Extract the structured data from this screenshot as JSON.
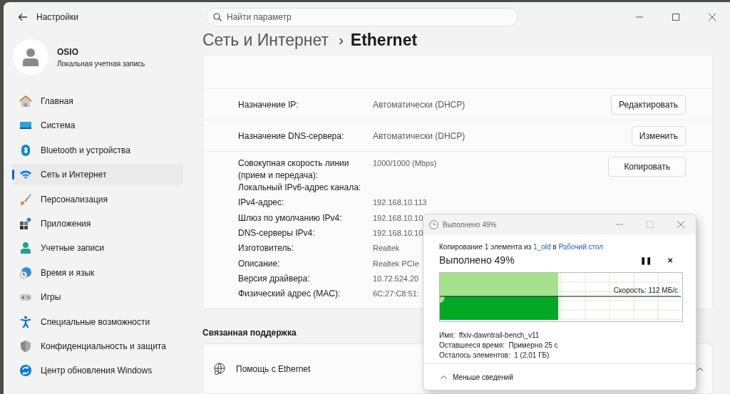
{
  "window": {
    "title": "Настройки",
    "search": {
      "placeholder": "Найти параметр"
    }
  },
  "profile": {
    "name": "OSIO",
    "account": "Локальная учетная запись"
  },
  "sidebar": {
    "items": [
      {
        "label": "Главная",
        "selected": false
      },
      {
        "label": "Система",
        "selected": false
      },
      {
        "label": "Bluetooth и устройства",
        "selected": false
      },
      {
        "label": "Сеть и Интернет",
        "selected": true
      },
      {
        "label": "Персонализация",
        "selected": false
      },
      {
        "label": "Приложения",
        "selected": false
      },
      {
        "label": "Учетные записи",
        "selected": false
      },
      {
        "label": "Время и язык",
        "selected": false
      },
      {
        "label": "Игры",
        "selected": false
      },
      {
        "label": "Специальные возможности",
        "selected": false
      },
      {
        "label": "Конфиденциальность и защита",
        "selected": false
      },
      {
        "label": "Центр обновления Windows",
        "selected": false
      }
    ]
  },
  "breadcrumb": {
    "parent": "Сеть и Интернет",
    "separator": "›",
    "current": "Ethernet"
  },
  "settings": [
    {
      "label": "Назначение IP:",
      "value": "Автоматически (DHCP)",
      "button": "Редактировать"
    },
    {
      "label": "Назначение DNS-сервера:",
      "value": "Автоматически (DHCP)",
      "button": "Изменить"
    }
  ],
  "properties": {
    "button": "Копировать",
    "rows": [
      {
        "label": "Совокупная скорость линии (прием и передача):",
        "value": "1000/1000 (Mbps)"
      },
      {
        "label": "Локальный IPv6-адрес канала:"
      },
      {
        "label": "IPv4-адрес:",
        "value": "192.168.10.113"
      },
      {
        "label": "Шлюз по умолчанию IPv4:",
        "value": "192.168.10.10"
      },
      {
        "label": "DNS-серверы IPv4:",
        "value": "192.168.10.10"
      },
      {
        "label": "Изготовитель:",
        "value": "Realtek"
      },
      {
        "label": "Описание:",
        "value": "Realtek PCIe"
      },
      {
        "label": "Версия драйвера:",
        "value": "10.72.524.20"
      },
      {
        "label": "Физический адрес (MAC):",
        "value": "6C:27:C8:51:"
      }
    ]
  },
  "related": {
    "heading": "Связанная поддержка",
    "items": [
      {
        "label": "Помощь с Ethernet",
        "expanded": true
      }
    ]
  },
  "copy_dialog": {
    "title": "Выполнено 49%",
    "summary": "Копирование 1 элемента из ",
    "source": "1_old",
    "joiner": " в ",
    "destination": "Рабочий стол",
    "status": "Выполнено 49%",
    "pause": "❚❚",
    "cancel": "✕",
    "level": 0.49,
    "speed": "Скорость: 112 МБ/с",
    "details": [
      {
        "label": "Имя:",
        "value": "ffxiv-dawntrail-bench_v11"
      },
      {
        "label": "Оставшееся время:",
        "value": "Примерно 25 с"
      },
      {
        "label": "Осталось элементов:",
        "value": "1 (2,01 ГБ)"
      }
    ],
    "toggle": "Меньше сведений"
  }
}
